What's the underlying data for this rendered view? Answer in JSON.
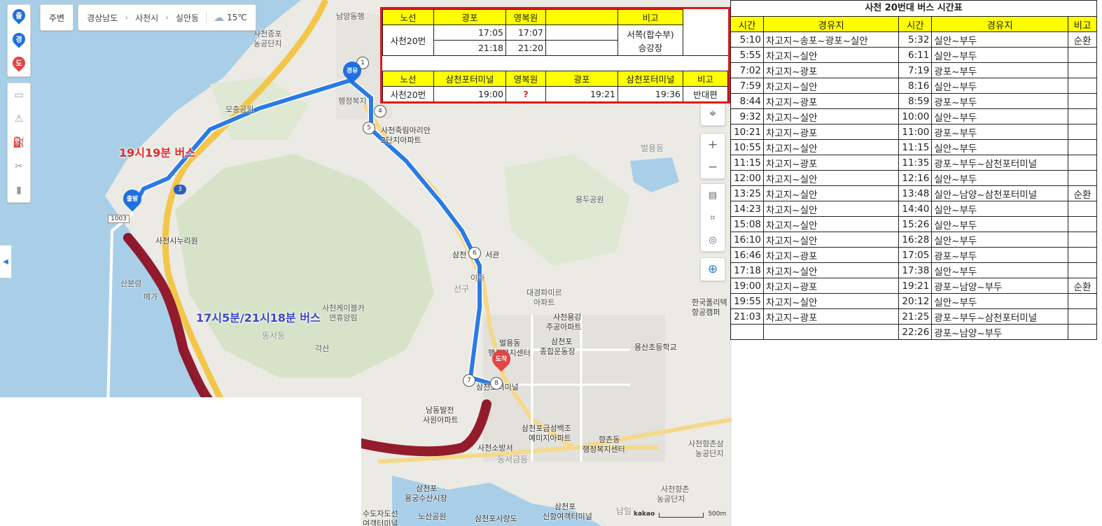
{
  "topbar": {
    "nearby_label": "주변",
    "breadcrumb": [
      "경상남도",
      "사천시",
      "실안동"
    ],
    "temperature": "15℃"
  },
  "left_toolbar": {
    "pins": [
      {
        "label": "출",
        "color": "#1f6fe0"
      },
      {
        "label": "경",
        "color": "#1f6fe0"
      },
      {
        "label": "도",
        "color": "#e44444"
      }
    ]
  },
  "map": {
    "markers": {
      "start": "출발",
      "via": "경유",
      "dest": "도착"
    },
    "stops": [
      "1",
      "4",
      "5",
      "6",
      "7",
      "8"
    ],
    "road_badges": [
      "1003",
      "3"
    ],
    "route_labels": {
      "red": "19시19분 버스",
      "blue": "17시5분/21시18분 버스"
    },
    "places": [
      "남양동행",
      "사천종포",
      "농공단지",
      "모충공원",
      "행정복지",
      "사천죽림아리안",
      "2단지아파트",
      "벌용동",
      "용두공원",
      "사천시누리원",
      "산분령",
      "메가",
      "사천케이블카",
      "연휴양림",
      "동서동",
      "각산",
      "삼천",
      "서관",
      "이마",
      "선구",
      "대경파미르",
      "아파트",
      "사천용강",
      "주공아파트",
      "벌용동",
      "행정복지센터",
      "삼천포",
      "종합운동장",
      "한국폴리텍",
      "항공캠퍼",
      "용산초등학교",
      "남동발전",
      "사원아파트",
      "삼천포금성백조",
      "예미지아파트",
      "향촌동",
      "행정복지센터",
      "사천소방서",
      "동서금동",
      "사천향촌삼",
      "농공단지",
      "삼천포",
      "용궁수산시장",
      "수도자도선",
      "여객터미널",
      "노산공원",
      "삼천포사량도",
      "삼천포",
      "신항여객터미널",
      "사천향촌",
      "농공단지",
      "남일",
      "삼천포터미널"
    ],
    "scale_brand": "kakao",
    "scale_text": "500m"
  },
  "overlay_table": {
    "header1": [
      "노선",
      "광포",
      "영복원",
      "",
      "비고"
    ],
    "route_name": "사천20번",
    "rows1": [
      {
        "gwangpo": "17:05",
        "yeongbok": "17:07"
      },
      {
        "gwangpo": "21:18",
        "yeongbok": "21:20"
      }
    ],
    "remark1_line1": "서쪽(합수부)",
    "remark1_line2": "승강장",
    "header2": [
      "노선",
      "삼천포터미널",
      "영복원",
      "광포",
      "삼천포터미널",
      "비고"
    ],
    "row2": {
      "route": "사천20번",
      "terminal": "19:00",
      "yeongbok": "?",
      "gwangpo": "19:21",
      "terminal2": "19:36",
      "remark": "반대편"
    }
  },
  "timetable": {
    "title": "사천 20번대 버스 시간표",
    "headers": [
      "시간",
      "경유지",
      "시간",
      "경유지",
      "비고"
    ],
    "rows": [
      [
        "5:10",
        "차고지~송포~광포~실안",
        "5:32",
        "실안~부두",
        "순환"
      ],
      [
        "5:55",
        "차고지~실안",
        "6:11",
        "실안~부두",
        ""
      ],
      [
        "7:02",
        "차고지~광포",
        "7:19",
        "광포~부두",
        ""
      ],
      [
        "7:59",
        "차고지~실안",
        "8:16",
        "실안~부두",
        ""
      ],
      [
        "8:44",
        "차고지~광포",
        "8:59",
        "광포~부두",
        ""
      ],
      [
        "9:32",
        "차고지~실안",
        "10:00",
        "실안~부두",
        ""
      ],
      [
        "10:21",
        "차고지~광포",
        "11:00",
        "광포~부두",
        ""
      ],
      [
        "10:55",
        "차고지~실안",
        "11:15",
        "실안~부두",
        ""
      ],
      [
        "11:15",
        "차고지~광포",
        "11:35",
        "광포~부두~삼천포터미널",
        ""
      ],
      [
        "12:00",
        "차고지~실안",
        "12:16",
        "실안~부두",
        ""
      ],
      [
        "13:25",
        "차고지~실안",
        "13:48",
        "실안~남양~삼천포터미널",
        "순환"
      ],
      [
        "14:23",
        "차고지~실안",
        "14:40",
        "실안~부두",
        ""
      ],
      [
        "15:08",
        "차고지~실안",
        "15:26",
        "실안~부두",
        ""
      ],
      [
        "16:10",
        "차고지~실안",
        "16:28",
        "실안~부두",
        ""
      ],
      [
        "16:46",
        "차고지~광포",
        "17:05",
        "광포~부두",
        ""
      ],
      [
        "17:18",
        "차고지~실안",
        "17:38",
        "실안~부두",
        ""
      ],
      [
        "19:00",
        "차고지~광포",
        "19:21",
        "광포~남양~부두",
        "순환"
      ],
      [
        "19:55",
        "차고지~실안",
        "20:12",
        "실안~부두",
        ""
      ],
      [
        "21:03",
        "차고지~광포",
        "21:25",
        "광포~부두~삼천포터미널",
        ""
      ],
      [
        "",
        "",
        "22:26",
        "광포~남양~부두",
        ""
      ]
    ]
  }
}
